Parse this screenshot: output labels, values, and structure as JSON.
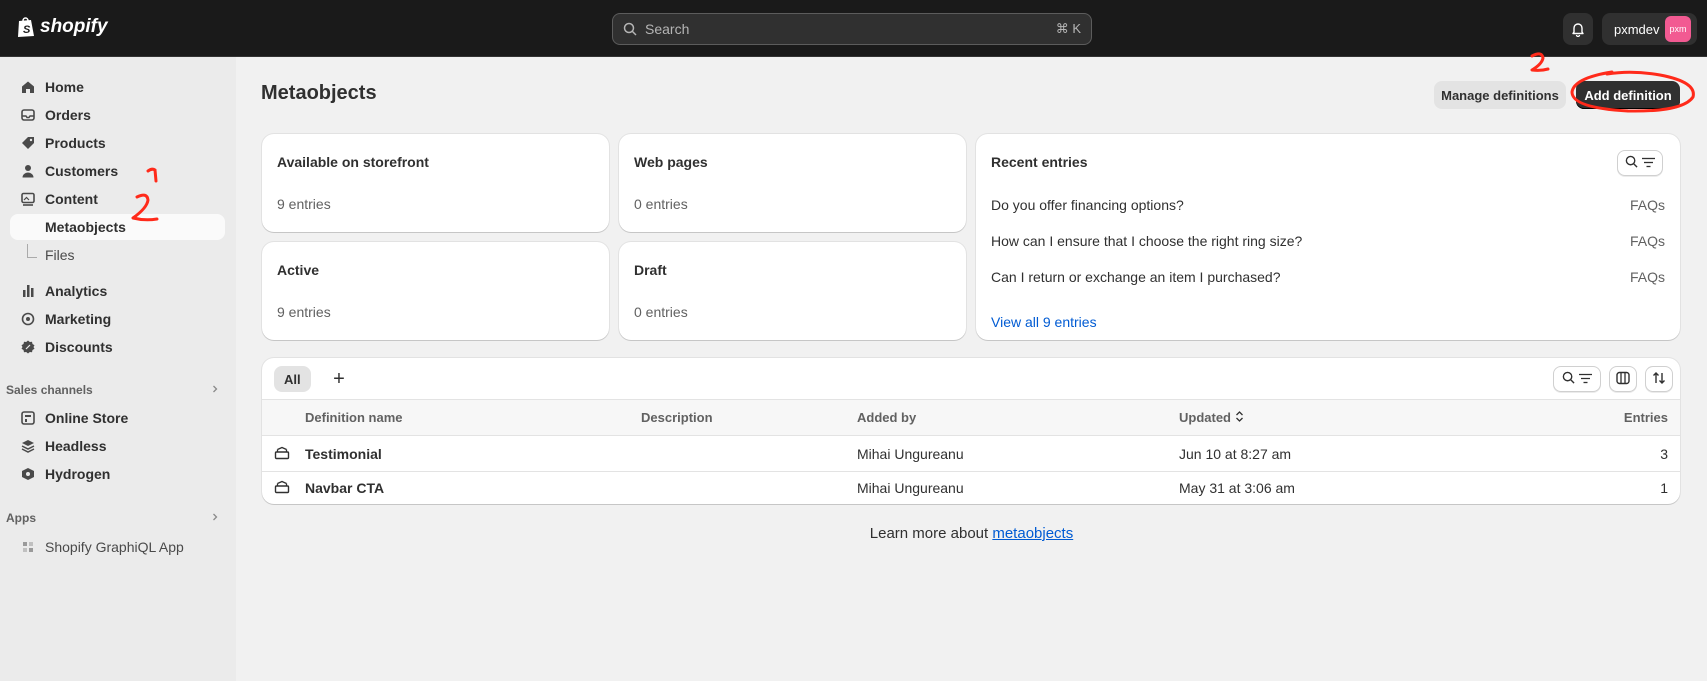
{
  "topbar": {
    "brand": "shopify",
    "search_placeholder": "Search",
    "search_shortcut": "⌘ K",
    "store_name": "pxmdev",
    "avatar_initials": "pxm"
  },
  "sidebar": {
    "items": [
      {
        "label": "Home",
        "icon": "home-icon"
      },
      {
        "label": "Orders",
        "icon": "inbox-icon"
      },
      {
        "label": "Products",
        "icon": "tag-icon"
      },
      {
        "label": "Customers",
        "icon": "person-icon"
      },
      {
        "label": "Content",
        "icon": "image-icon"
      },
      {
        "label": "Metaobjects",
        "icon": ""
      },
      {
        "label": "Files",
        "icon": ""
      },
      {
        "label": "Analytics",
        "icon": "bar-chart-icon"
      },
      {
        "label": "Marketing",
        "icon": "target-icon"
      },
      {
        "label": "Discounts",
        "icon": "discount-icon"
      }
    ],
    "sales_channels_label": "Sales channels",
    "sales_channels": [
      {
        "label": "Online Store",
        "icon": "store-icon"
      },
      {
        "label": "Headless",
        "icon": "headless-icon"
      },
      {
        "label": "Hydrogen",
        "icon": "hydrogen-icon"
      }
    ],
    "apps_label": "Apps",
    "apps": [
      {
        "label": "Shopify GraphiQL App",
        "icon": "app-icon"
      }
    ]
  },
  "page": {
    "title": "Metaobjects",
    "manage_button": "Manage definitions",
    "add_button": "Add definition"
  },
  "stats": [
    {
      "title": "Available on storefront",
      "value": "9 entries"
    },
    {
      "title": "Web pages",
      "value": "0 entries"
    },
    {
      "title": "Active",
      "value": "9 entries"
    },
    {
      "title": "Draft",
      "value": "0 entries"
    }
  ],
  "recent": {
    "title": "Recent entries",
    "entries": [
      {
        "text": "Do you offer financing options?",
        "tag": "FAQs"
      },
      {
        "text": "How can I ensure that I choose the right ring size?",
        "tag": "FAQs"
      },
      {
        "text": "Can I return or exchange an item I purchased?",
        "tag": "FAQs"
      }
    ],
    "view_all": "View all 9 entries"
  },
  "table": {
    "tab_all": "All",
    "tab_add": "+",
    "headers": {
      "name": "Definition name",
      "description": "Description",
      "added_by": "Added by",
      "updated": "Updated",
      "entries": "Entries"
    },
    "rows": [
      {
        "name": "Testimonial",
        "description": "",
        "added_by": "Mihai Ungureanu",
        "updated": "Jun 10 at 8:27 am",
        "entries": "3"
      },
      {
        "name": "Navbar CTA",
        "description": "",
        "added_by": "Mihai Ungureanu",
        "updated": "May 31 at 3:06 am",
        "entries": "1"
      }
    ]
  },
  "footer": {
    "learn_prefix": "Learn more about ",
    "learn_link": "metaobjects"
  },
  "annotations": {
    "color": "#ff2a1a",
    "step_one": "1",
    "step_two": "2",
    "step_two_top": "2"
  }
}
